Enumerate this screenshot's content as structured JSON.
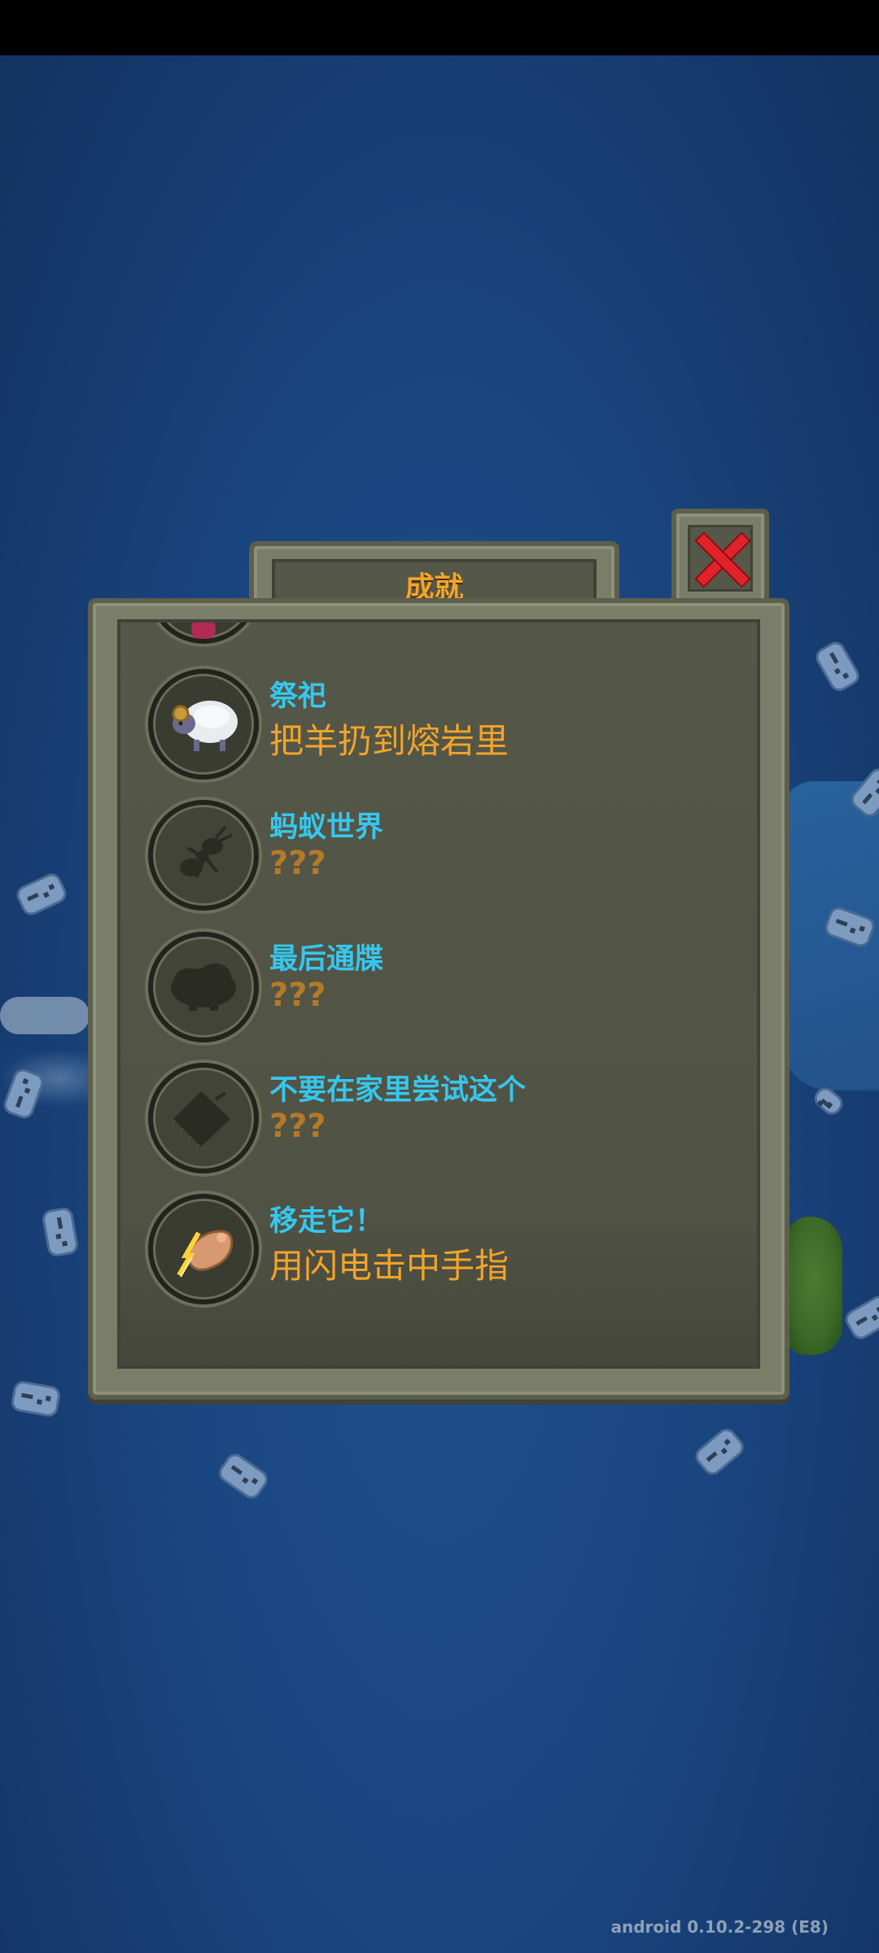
{
  "dialog": {
    "title": "成就",
    "close_icon": "close-x-icon"
  },
  "achievements": [
    {
      "icon": "partial-achievement-icon",
      "name": "",
      "description": "",
      "unlocked": true
    },
    {
      "icon": "sheep-icon",
      "name": "祭祀",
      "description": "把羊扔到熔岩里",
      "unlocked": true
    },
    {
      "icon": "ant-icon",
      "name": "蚂蚁世界",
      "description": "???",
      "unlocked": false
    },
    {
      "icon": "cloud-icon",
      "name": "最后通牒",
      "description": "???",
      "unlocked": false
    },
    {
      "icon": "bomb-icon",
      "name": "不要在家里尝试这个",
      "description": "???",
      "unlocked": false
    },
    {
      "icon": "lightning-finger-icon",
      "name": "移走它！",
      "description": "用闪电击中手指",
      "unlocked": true
    }
  ],
  "footer": {
    "version": "android 0.10.2-298 (E8)"
  },
  "colors": {
    "title": "#f2a42a",
    "achievement_name": "#36c7ee",
    "achievement_desc": "#f2a42a",
    "ocean": "#1a4680",
    "panel": "#555748"
  }
}
